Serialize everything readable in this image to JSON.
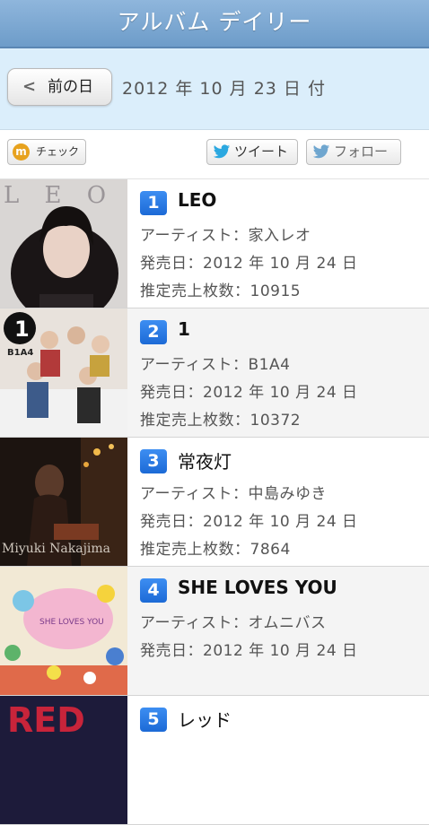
{
  "header": {
    "title": "アルバム デイリー"
  },
  "date_bar": {
    "prev_label": "前の日",
    "date": "2012 年 10 月 23 日 付"
  },
  "social": {
    "check_label": "チェック",
    "tweet_label": "ツイート",
    "follow_label": "フォロー"
  },
  "albums": [
    {
      "rank": "1",
      "title": "LEO",
      "artist": "アーティスト：家入レオ",
      "release": "発売日：2012 年 10 月 24 日",
      "sales": "推定売上枚数：10915",
      "cover_text": "L E O"
    },
    {
      "rank": "2",
      "title": "1",
      "artist": "アーティスト：B1A4",
      "release": "発売日：2012 年 10 月 24 日",
      "sales": "推定売上枚数：10372",
      "cover_text": "B1A4"
    },
    {
      "rank": "3",
      "title": "常夜灯",
      "artist": "アーティスト：中島みゆき",
      "release": "発売日：2012 年 10 月 24 日",
      "sales": "推定売上枚数：7864",
      "cover_text": "Miyuki Nakajima"
    },
    {
      "rank": "4",
      "title": "SHE LOVES YOU",
      "artist": "アーティスト：オムニバス",
      "release": "発売日：2012 年 10 月 24 日",
      "sales": "",
      "cover_text": "SHE LOVES YOU"
    },
    {
      "rank": "5",
      "title": "レッド",
      "artist": "",
      "release": "",
      "sales": "",
      "cover_text": "RED"
    }
  ],
  "colors": {
    "header": "#7aa7d3",
    "date_bar": "#dbeefb",
    "rank_badge": "#2a7be4"
  }
}
